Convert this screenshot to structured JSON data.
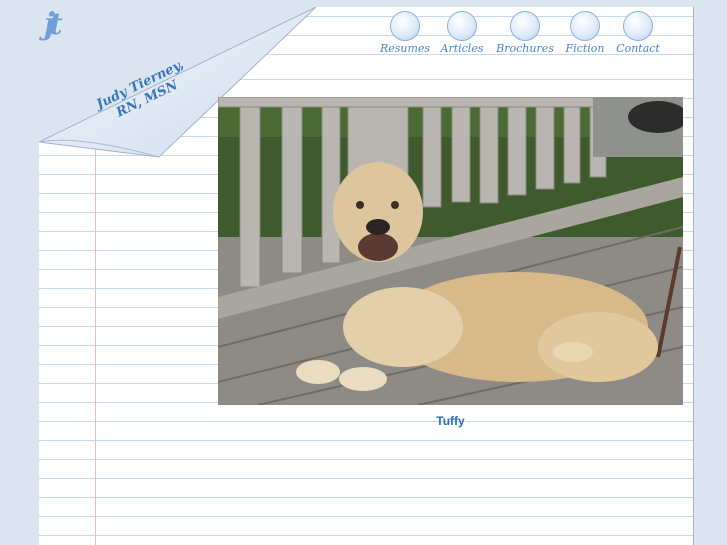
{
  "brand": {
    "logo_text": "jt",
    "signature_line1": "Judy Tierney,",
    "signature_line2": "RN, MSN"
  },
  "nav": [
    {
      "label": "Resumes",
      "icon": "notepad-icon"
    },
    {
      "label": "Articles",
      "icon": "books-icon"
    },
    {
      "label": "Brochures",
      "icon": "info-icon"
    },
    {
      "label": "Fiction",
      "icon": "hearts-icon"
    },
    {
      "label": "Contact",
      "icon": "envelope-icon"
    }
  ],
  "photo": {
    "caption": "Tuffy"
  },
  "colors": {
    "background": "#dbe5f0",
    "accent": "#2a6fc0",
    "nav_text": "#4d86c9",
    "rule_line": "#c9d7ea",
    "margin_line": "#f3b8b8"
  }
}
